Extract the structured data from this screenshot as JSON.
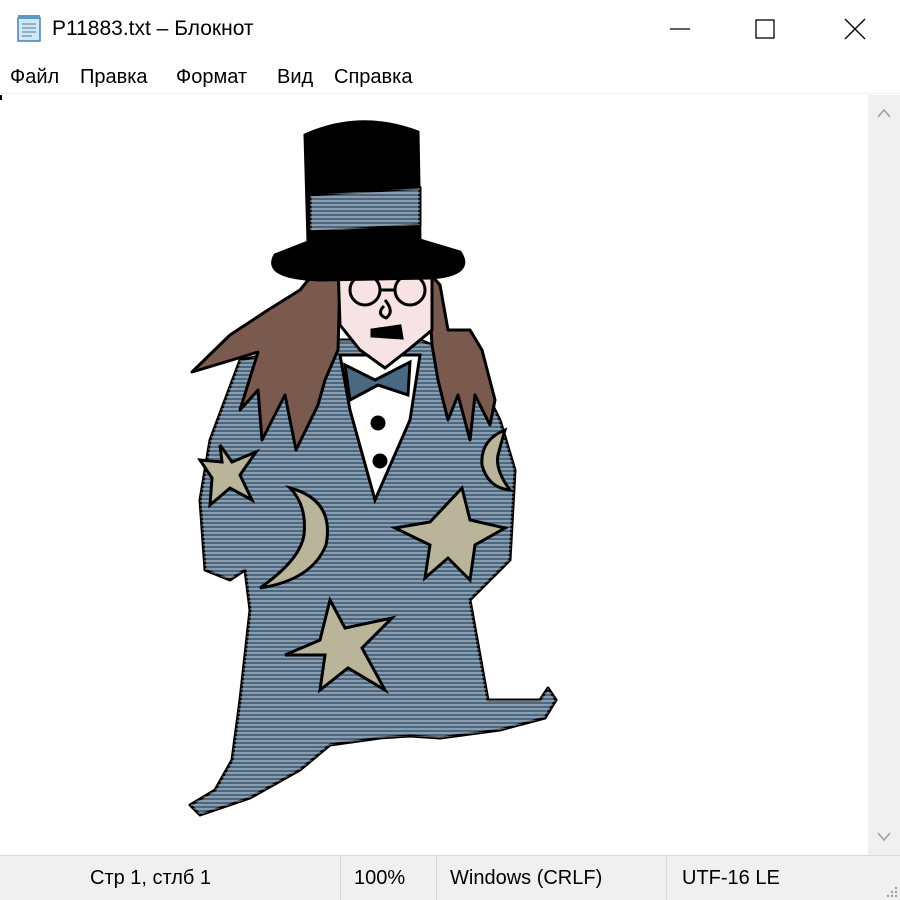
{
  "window": {
    "title": "P11883.txt – Блокнот",
    "controls": {
      "minimize": "minimize",
      "maximize": "maximize",
      "close": "close"
    }
  },
  "menu": {
    "items": [
      "Файл",
      "Правка",
      "Формат",
      "Вид",
      "Справка"
    ]
  },
  "editor": {
    "content_description": "ASCII-art style picture of a figure in a top hat and star-and-moon robe"
  },
  "status": {
    "position": "Стр 1, стлб 1",
    "zoom": "100%",
    "line_endings": "Windows (CRLF)",
    "encoding": "UTF-16 LE"
  },
  "colors": {
    "robe": "#4a6882",
    "hair": "#7a5a4e",
    "hat": "#000000",
    "skin": "#f7e3e3",
    "star": "#b9b49a",
    "statusbar": "#f0f0f0"
  },
  "icons": {
    "app": "notepad-icon",
    "scroll_up": "chevron-up-icon",
    "scroll_down": "chevron-down-icon"
  }
}
